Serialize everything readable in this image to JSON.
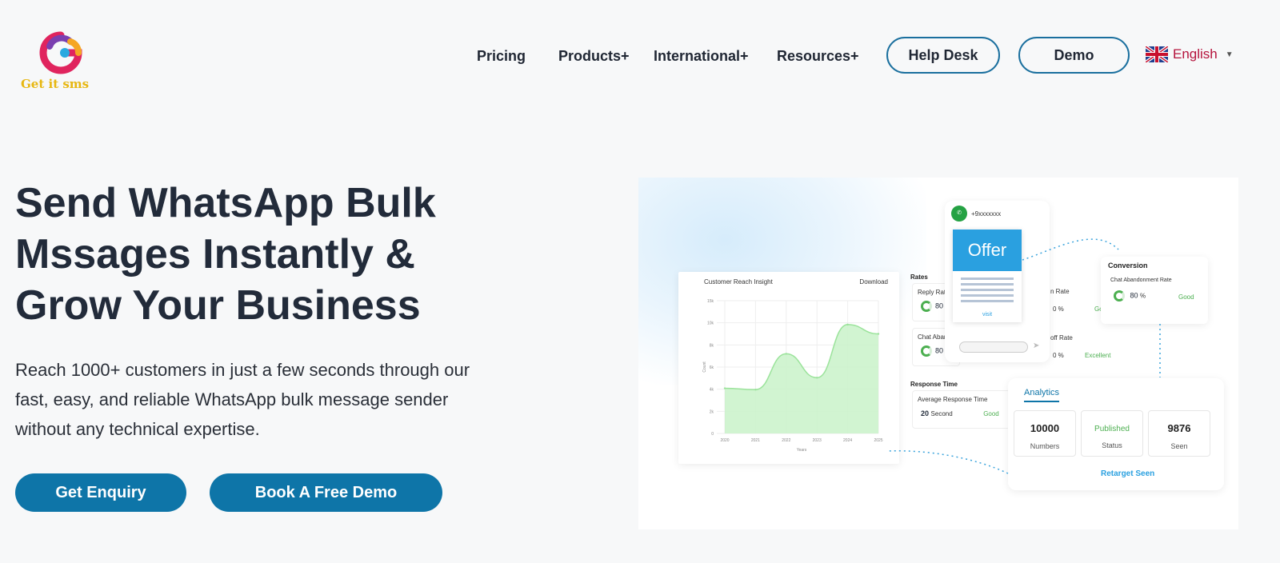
{
  "brand": {
    "name": "Get it sms"
  },
  "nav": {
    "items": [
      {
        "label": "Pricing"
      },
      {
        "label": "Products+"
      },
      {
        "label": "International+"
      },
      {
        "label": "Resources+"
      }
    ],
    "help_desk": "Help Desk",
    "demo": "Demo",
    "language": "English"
  },
  "hero": {
    "title": "Send WhatsApp Bulk Mssages Instantly & Grow Your Business",
    "subtitle": "Reach 1000+ customers in just a few seconds through our fast, easy, and reliable WhatsApp bulk message sender without any technical expertise.",
    "cta_primary": "Get Enquiry",
    "cta_secondary": "Book A Free Demo"
  },
  "illustration": {
    "chart_card": {
      "title": "Customer Reach Insight",
      "download": "Download"
    },
    "rates": {
      "heading": "Rates",
      "reply_rate": "Reply Rate",
      "reply_value": "80",
      "chat_abandon_short": "Chat Aban",
      "chat_value": "80",
      "open_rate_short": "n Rate",
      "open_value": "0 %",
      "open_status": "Go",
      "dropoff_short": "off Rate",
      "dropoff_value": "0 %",
      "dropoff_status": "Excellent",
      "response_heading": "Response Time",
      "avg_response": "Average Response Time",
      "avg_value": "20",
      "avg_unit": "Second",
      "avg_status": "Good"
    },
    "phone": {
      "number": "+9xxxxxxx",
      "offer": "Offer",
      "link": "visit"
    },
    "conversion": {
      "title": "Conversion",
      "metric": "Chat Abandonment Rate",
      "value": "80",
      "unit": "%",
      "status": "Good"
    },
    "analytics": {
      "title": "Analytics",
      "stats": [
        {
          "value": "10000",
          "label": "Numbers"
        },
        {
          "value": "Published",
          "label": "Status"
        },
        {
          "value": "9876",
          "label": "Seen"
        }
      ],
      "link": "Retarget Seen"
    }
  },
  "chart_data": {
    "type": "area",
    "title": "Customer Reach Insight",
    "xlabel": "Years",
    "ylabel": "Count",
    "x": [
      "2020",
      "2021",
      "2022",
      "2023",
      "2024",
      "2025"
    ],
    "y_ticks": [
      "0",
      "2k",
      "4k",
      "6k",
      "8k",
      "10k",
      "15k"
    ],
    "series": [
      {
        "values": [
          3.4,
          3.3,
          6.0,
          4.2,
          8.2,
          7.5
        ]
      }
    ],
    "ylim": [
      0,
      10
    ],
    "colors": {
      "fill": "#c9f2c9",
      "line": "#9be39b"
    }
  },
  "colors": {
    "accent": "#0e75a8",
    "heading": "#222b3a",
    "brand_yellow": "#e7b711",
    "lang": "#b5123c"
  }
}
